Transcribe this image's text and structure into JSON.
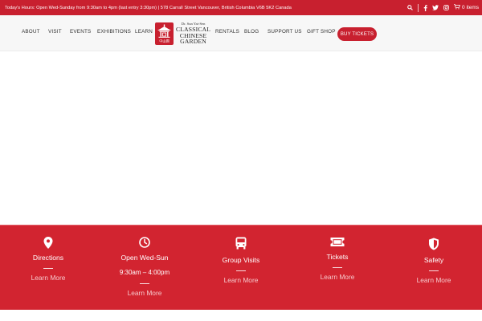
{
  "topbar": {
    "hours_text": "Today's Hours: Open Wed-Sunday from 9:30am to 4pm (last entry 3:30pm) | 578 Carrall Street Vancouver, British Columbia V6B 5K2 Canada",
    "cart_label": "0 items",
    "icons": [
      "search-icon",
      "facebook-icon",
      "twitter-icon",
      "instagram-icon",
      "cart-icon"
    ]
  },
  "nav": {
    "about": "ABOUT",
    "visit": "VISIT",
    "events": "EVENTS",
    "exhibitions": "EXHIBITIONS",
    "learn": "LEARN",
    "rentals": "RENTALS",
    "blog": "BLOG",
    "support": "SUPPORT US",
    "gift_shop": "GIFT SHOP",
    "buy_tickets": "BUY TICKETS"
  },
  "logo": {
    "line1": "Dr. Sun Yat-Sen",
    "line2": "CLASSICAL",
    "line3": "CHINESE",
    "line4": "GARDEN"
  },
  "info": [
    {
      "icon": "map-pin-icon",
      "title": "Directions",
      "link": "Learn More"
    },
    {
      "icon": "clock-icon",
      "title": "Open Wed-Sun",
      "subtitle": "9:30am – 4:00pm",
      "link": "Learn More"
    },
    {
      "icon": "bus-icon",
      "title": "Group Visits",
      "link": "Learn More"
    },
    {
      "icon": "ticket-icon",
      "title": "Tickets",
      "link": "Learn More"
    },
    {
      "icon": "shield-icon",
      "title": "Safety",
      "link": "Learn More"
    }
  ],
  "colors": {
    "brand_red": "#c8202f",
    "strip_red": "#d22430",
    "header_bg": "#f7f7f7"
  }
}
